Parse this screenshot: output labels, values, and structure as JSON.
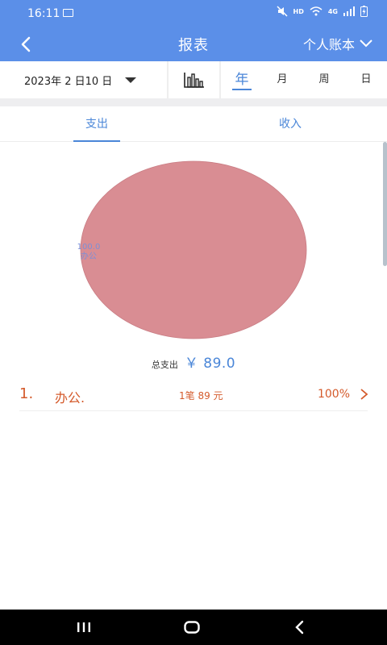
{
  "status_bar": {
    "time": "16:11",
    "network_hd": "HD",
    "network_4g": "4G"
  },
  "header": {
    "title": "报表",
    "account_book": "个人账本"
  },
  "filters": {
    "date": "2023年 2 日10 日",
    "periods": [
      "年",
      "月",
      "周",
      "日"
    ],
    "active_period": "年"
  },
  "tabs": [
    {
      "label": "支出",
      "active": true
    },
    {
      "label": "收入",
      "active": false
    }
  ],
  "chart_data": {
    "type": "pie",
    "slices": [
      {
        "label": "办公",
        "value": 100.0,
        "color": "#d98d93"
      }
    ]
  },
  "pie_labels": {
    "value_text": "100.0",
    "category_text": "办公"
  },
  "total": {
    "label": "总支出",
    "amount": "￥ 89.0"
  },
  "list": [
    {
      "rank": "1.",
      "name": "办公.",
      "count": "1笔 89 元",
      "percent": "100%"
    }
  ],
  "colors": {
    "primary": "#5b8fe8",
    "accent": "#4a86d8",
    "list_text": "#d45a2b"
  }
}
